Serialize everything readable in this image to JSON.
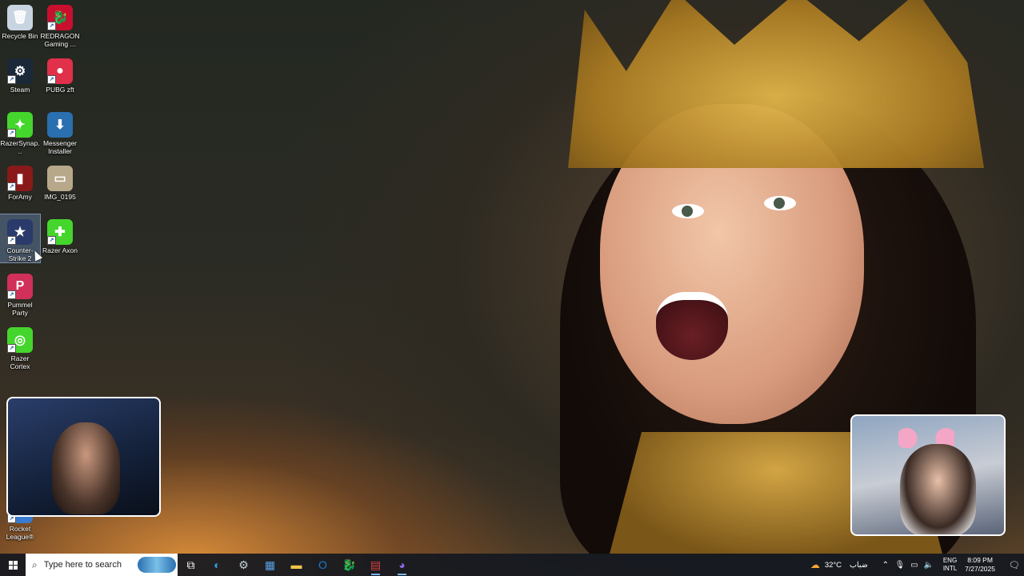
{
  "desktop": {
    "icons": [
      {
        "label": "Recycle Bin",
        "icon": "recycle-bin-icon",
        "color": "#c8d4e0",
        "glyph": "🗑",
        "shortcut": false
      },
      {
        "label": "REDRAGON Gaming ...",
        "icon": "redragon-icon",
        "color": "#c8102e",
        "glyph": "🐉",
        "shortcut": true
      },
      {
        "label": "Steam",
        "icon": "steam-icon",
        "color": "#1b2838",
        "glyph": "⚙",
        "shortcut": true
      },
      {
        "label": "PUBG zft",
        "icon": "pubg-icon",
        "color": "#e0304a",
        "glyph": "●",
        "shortcut": true
      },
      {
        "label": "RazerSynap...",
        "icon": "razer-synapse-icon",
        "color": "#44d62c",
        "glyph": "✦",
        "shortcut": true
      },
      {
        "label": "Messenger Installer",
        "icon": "messenger-installer-icon",
        "color": "#2a6fb0",
        "glyph": "⬇",
        "shortcut": false
      },
      {
        "label": "ForAmy",
        "icon": "book-icon",
        "color": "#8a1a1a",
        "glyph": "▮",
        "shortcut": true
      },
      {
        "label": "IMG_0195",
        "icon": "image-file-icon",
        "color": "#b8a88a",
        "glyph": "▭",
        "shortcut": false
      },
      {
        "label": "Counter-Strike 2",
        "icon": "counter-strike-icon",
        "color": "#2a3a6a",
        "glyph": "★",
        "shortcut": true,
        "selected": true
      },
      {
        "label": "Razer Axon",
        "icon": "razer-axon-icon",
        "color": "#44d62c",
        "glyph": "✚",
        "shortcut": true
      },
      {
        "label": "Pummel Party",
        "icon": "pummel-party-icon",
        "color": "#d0305a",
        "glyph": "P",
        "shortcut": true
      },
      {
        "label": "Razer Cortex",
        "icon": "razer-cortex-icon",
        "color": "#44d62c",
        "glyph": "◎",
        "shortcut": true
      },
      {
        "label": "Rocket League®",
        "icon": "rocket-league-icon",
        "color": "#3a7ad0",
        "glyph": "◆",
        "shortcut": true
      }
    ]
  },
  "taskbar": {
    "search_placeholder": "Type here to search",
    "apps": [
      {
        "name": "task-view-icon",
        "glyph": "⧉",
        "color": "#ffffff"
      },
      {
        "name": "edge-icon",
        "glyph": "◐",
        "color": "#2fa0e0"
      },
      {
        "name": "steam-icon",
        "glyph": "⚙",
        "color": "#c6d4df"
      },
      {
        "name": "store-icon",
        "glyph": "▦",
        "color": "#5aa0e8"
      },
      {
        "name": "file-explorer-icon",
        "glyph": "▬",
        "color": "#f2c44a"
      },
      {
        "name": "outlook-icon",
        "glyph": "O",
        "color": "#1a78d0"
      },
      {
        "name": "redragon-icon",
        "glyph": "🐉",
        "color": "#c8102e"
      },
      {
        "name": "voicemeeter-icon",
        "glyph": "▤",
        "color": "#e04040"
      },
      {
        "name": "discord-icon",
        "glyph": "◕",
        "color": "#8a6af0"
      }
    ],
    "weather": {
      "temp": "32°C",
      "desc": "ضباب"
    },
    "language": {
      "line1": "ENG",
      "line2": "INTL"
    },
    "clock": {
      "time": "8:09 PM",
      "date": "7/27/2025"
    }
  }
}
